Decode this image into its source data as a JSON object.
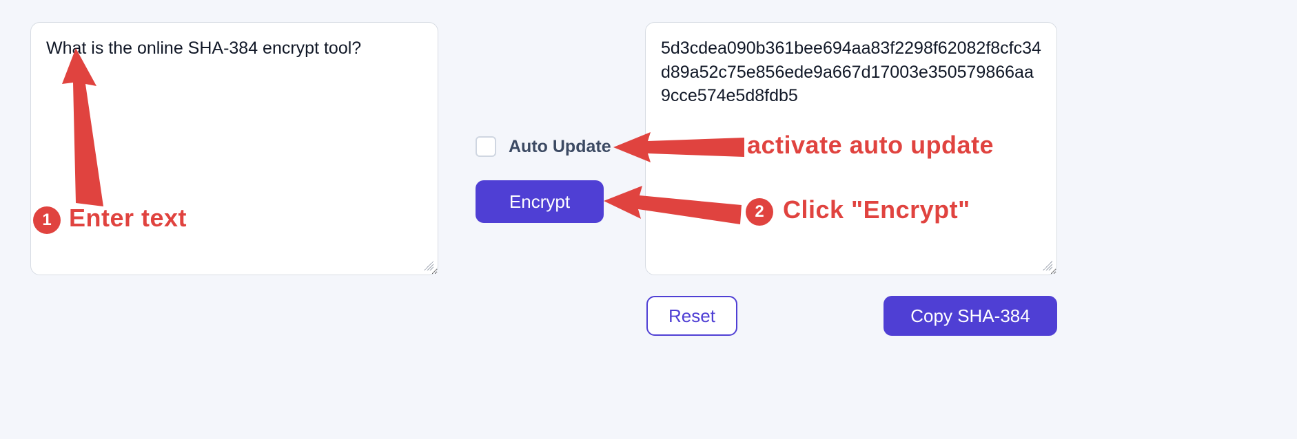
{
  "input_panel": {
    "value": "What is the online SHA-384 encrypt tool?"
  },
  "output_panel": {
    "value": "5d3cdea090b361bee694aa83f2298f62082f8cfc34d89a52c75e856ede9a667d17003e350579866aa9cce574e5d8fdb5"
  },
  "controls": {
    "auto_update_label": "Auto Update",
    "auto_update_checked": false,
    "encrypt_label": "Encrypt"
  },
  "buttons": {
    "reset": "Reset",
    "copy": "Copy SHA-384"
  },
  "annotations": {
    "step1_badge": "1",
    "step1_text": "Enter text",
    "auto_update_text": "activate auto update",
    "step2_badge": "2",
    "step2_text": "Click \"Encrypt\""
  },
  "colors": {
    "accent": "#4f3fd4",
    "annotation": "#e0433f"
  }
}
